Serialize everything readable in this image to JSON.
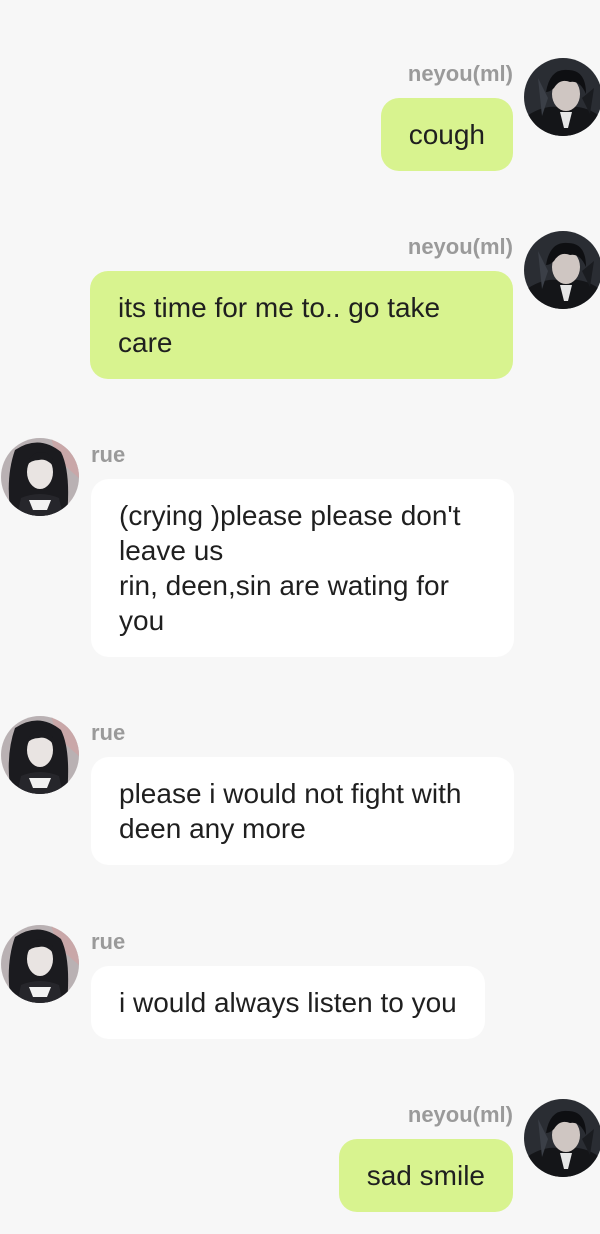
{
  "chat": {
    "messages": [
      {
        "side": "right",
        "sender": "neyou(ml)",
        "text": "cough",
        "avatar_icon": "avatar-dark-hair-boy-icon"
      },
      {
        "side": "right",
        "sender": "neyou(ml)",
        "text": "its time for me to.. go take\ncare",
        "avatar_icon": "avatar-dark-hair-boy-icon"
      },
      {
        "side": "left",
        "sender": "rue",
        "text": "(crying )please please don't\nleave us\nrin, deen,sin are wating for\nyou",
        "avatar_icon": "avatar-long-hair-girl-icon"
      },
      {
        "side": "left",
        "sender": "rue",
        "text": "please i would not fight with\ndeen any more",
        "avatar_icon": "avatar-long-hair-girl-icon"
      },
      {
        "side": "left",
        "sender": "rue",
        "text": "i would always listen to you",
        "avatar_icon": "avatar-long-hair-girl-icon"
      },
      {
        "side": "right",
        "sender": "neyou(ml)",
        "text": "sad smile",
        "avatar_icon": "avatar-dark-hair-boy-icon"
      }
    ]
  },
  "colors": {
    "background": "#f7f7f7",
    "outgoing_bubble": "#d8f38f",
    "incoming_bubble": "#ffffff",
    "sender_name": "#9a9a9a",
    "message_text": "#1f1f1f"
  }
}
